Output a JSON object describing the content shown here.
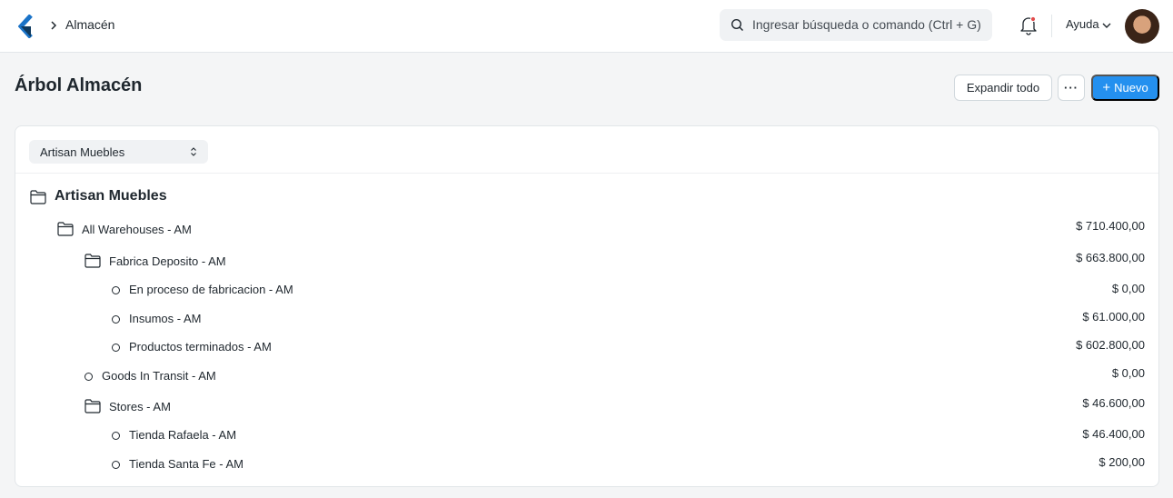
{
  "navbar": {
    "breadcrumb": "Almacén",
    "search_placeholder": "Ingresar búsqueda o comando (Ctrl + G)",
    "help_label": "Ayuda"
  },
  "page": {
    "title": "Árbol Almacén",
    "expand_all_label": "Expandir todo",
    "more_label": "···",
    "new_label": "Nuevo"
  },
  "company_filter": {
    "value": "Artisan Muebles"
  },
  "tree": {
    "root": "Artisan Muebles",
    "nodes": [
      {
        "label": "All Warehouses - AM",
        "amount": "$ 710.400,00",
        "group": true
      },
      {
        "label": "Fabrica Deposito - AM",
        "amount": "$ 663.800,00",
        "group": true
      },
      {
        "label": "En proceso de fabricacion - AM",
        "amount": "$ 0,00",
        "group": false
      },
      {
        "label": "Insumos - AM",
        "amount": "$ 61.000,00",
        "group": false
      },
      {
        "label": "Productos terminados - AM",
        "amount": "$ 602.800,00",
        "group": false
      },
      {
        "label": "Goods In Transit - AM",
        "amount": "$ 0,00",
        "group": false
      },
      {
        "label": "Stores - AM",
        "amount": "$ 46.600,00",
        "group": true
      },
      {
        "label": "Tienda Rafaela - AM",
        "amount": "$ 46.400,00",
        "group": false
      },
      {
        "label": "Tienda Santa Fe - AM",
        "amount": "$ 200,00",
        "group": false
      }
    ]
  },
  "colors": {
    "primary": "#2490ef",
    "notification_dot": "#e24c4c"
  },
  "icons": [
    "app-logo-icon",
    "chevron-right-icon",
    "search-icon",
    "bell-icon",
    "chevron-down-icon",
    "folder-icon",
    "leaf-circle-icon",
    "select-caret-icon"
  ]
}
